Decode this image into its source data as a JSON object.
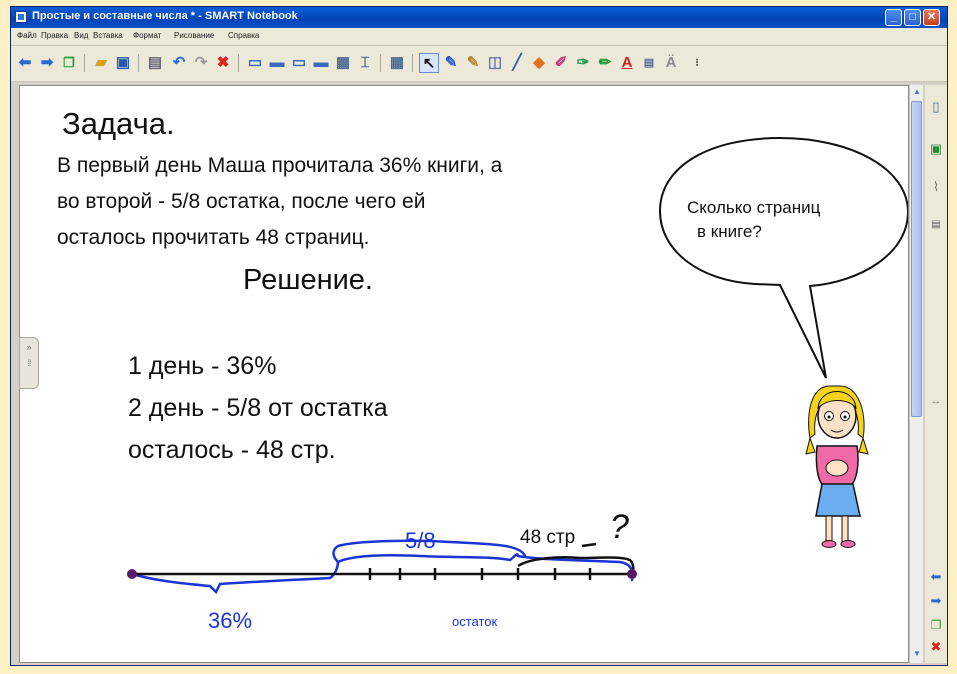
{
  "window": {
    "title": "Простые и составные числа * - SMART Notebook"
  },
  "menu": [
    "Файл",
    "Правка",
    "Вид",
    "Вставка",
    "Формат",
    "Рисование",
    "Справка"
  ],
  "toolbar": {
    "icons": [
      "back-arrow-icon",
      "forward-arrow-icon",
      "new-page-icon",
      "open-folder-icon",
      "save-icon",
      "paste-icon",
      "undo-icon",
      "redo-icon",
      "delete-icon",
      "screen-shade-icon",
      "full-screen-icon",
      "dual-display-icon",
      "show-table-icon",
      "capture-icon",
      "table-icon",
      "select-arrow-icon",
      "pen-icon",
      "creative-pen-icon",
      "eraser-icon",
      "line-icon",
      "shape-icon",
      "fill-icon",
      "magic-pen-icon",
      "shape-recognition-icon",
      "text-icon",
      "properties-icon",
      "more-icon"
    ]
  },
  "page": {
    "title": "Задача.",
    "problem_lines": [
      "В первый день Маша прочитала 36% книги, а",
      "во второй - 5/8 остатка, после чего ей",
      "осталось прочитать 48 страниц."
    ],
    "solution_heading": "Решение.",
    "data_lines": [
      "1 день - 36%",
      "2 день - 5/8 от остатка",
      "осталось - 48 стр."
    ],
    "speech_bubble": [
      "Сколько страниц",
      "в книге?"
    ],
    "diagram": {
      "label_fraction": "5/8",
      "label_remaining": "48 стр",
      "label_question": "?",
      "label_percent": "36%",
      "label_remainder": "остаток"
    }
  },
  "colors": {
    "ink_blue": "#1a35d4",
    "segment_line": "#111111",
    "endpoint": "#5a1a6a"
  }
}
